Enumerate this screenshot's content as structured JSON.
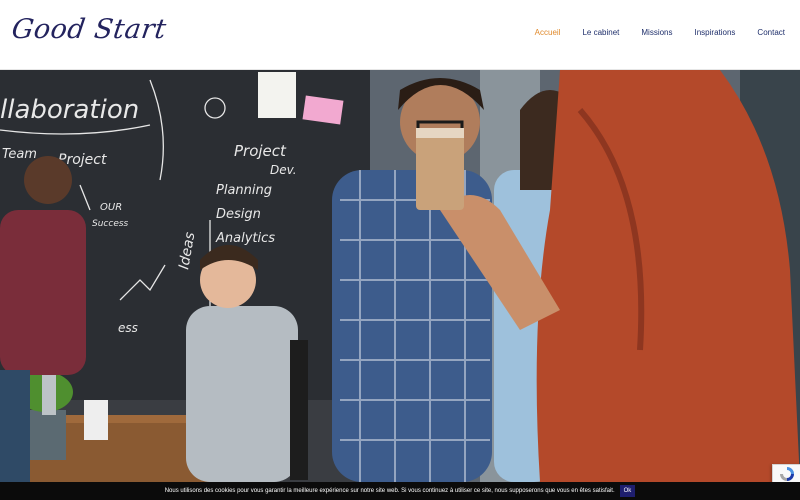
{
  "brand": {
    "logo_text": "Good Start"
  },
  "nav": {
    "items": [
      {
        "label": "Accueil",
        "active": true
      },
      {
        "label": "Le cabinet",
        "active": false
      },
      {
        "label": "Missions",
        "active": false
      },
      {
        "label": "Inspirations",
        "active": false
      },
      {
        "label": "Contact",
        "active": false
      }
    ]
  },
  "hero": {
    "image": "office-collaboration-photo",
    "chalkboard_words": [
      "llaboration",
      "Team",
      "Project",
      "OUR",
      "Success",
      "Project",
      "Dev.",
      "Planning",
      "Design",
      "Analytics",
      "Ideas",
      "ess"
    ]
  },
  "cookie_bar": {
    "text": "Nous utilisons des cookies pour vous garantir la meilleure expérience sur notre site web. Si vous continuez à utiliser ce site, nous supposerons que vous en êtes satisfait.",
    "ok_label": "Ok"
  },
  "colors": {
    "brand": "#23235e",
    "nav": "#1f2f6b",
    "nav_active": "#e08a2c",
    "cookie_bg": "#0b0b0b",
    "ok_bg": "#1e1e6e"
  }
}
